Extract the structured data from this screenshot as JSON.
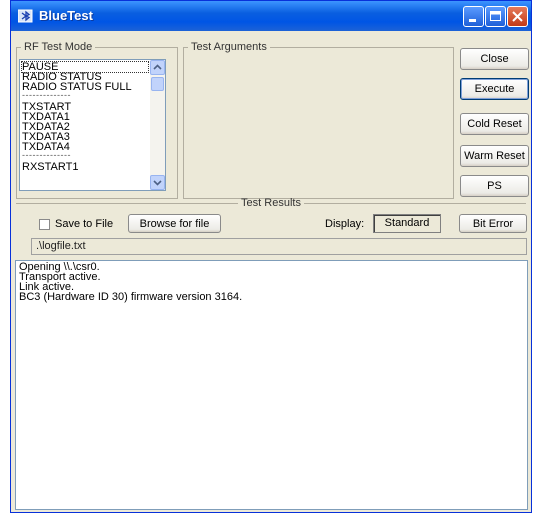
{
  "window": {
    "title": "BlueTest",
    "controls": {
      "minimize": "minimize",
      "maximize": "maximize",
      "close": "close"
    }
  },
  "rf_test_mode": {
    "legend": "RF Test Mode",
    "items": [
      {
        "label": "PAUSE",
        "selected": true
      },
      {
        "label": "RADIO STATUS"
      },
      {
        "label": "RADIO STATUS FULL"
      },
      {
        "separator": true,
        "label": "- - - - - - - - - - - - - -"
      },
      {
        "label": "TXSTART"
      },
      {
        "label": "TXDATA1"
      },
      {
        "label": "TXDATA2"
      },
      {
        "label": "TXDATA3"
      },
      {
        "label": "TXDATA4"
      },
      {
        "separator": true,
        "label": "- - - - - - - - - - - - - -"
      },
      {
        "label": "RXSTART1"
      }
    ]
  },
  "test_arguments": {
    "legend": "Test Arguments"
  },
  "buttons": {
    "close": "Close",
    "execute": "Execute",
    "cold_reset": "Cold Reset",
    "warm_reset": "Warm Reset",
    "ps": "PS"
  },
  "test_results": {
    "legend": "Test Results",
    "save_to_file_label": "Save to File",
    "save_to_file_checked": false,
    "browse_button": "Browse for file",
    "display_label": "Display:",
    "display_value": "Standard",
    "bit_error_button": "Bit Error",
    "file_path": ".\\logfile.txt",
    "output_lines": [
      "Opening \\\\.\\csr0.",
      "Transport active.",
      "Link active.",
      "BC3 (Hardware ID 30) firmware version 3164."
    ]
  },
  "colors": {
    "titlebar": "#0055e5",
    "window_face": "#ece9d8",
    "field_border": "#7f9db9"
  },
  "icons": {
    "app": "bluetest-app-icon"
  }
}
